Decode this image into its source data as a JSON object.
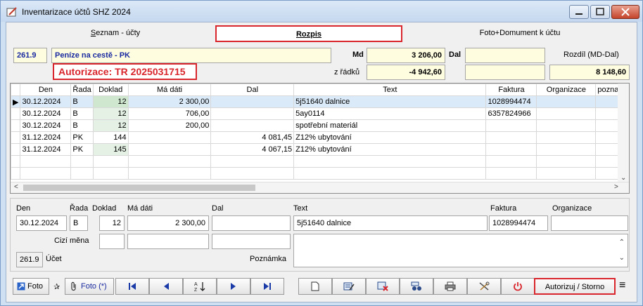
{
  "window": {
    "title": "Inventarizace účtů SHZ 2024"
  },
  "tabs": [
    {
      "label": "Seznam - účty",
      "underline": "S",
      "rest": "eznam - účty"
    },
    {
      "label": "Rozpis"
    },
    {
      "label": "Foto+Domument k účtu"
    }
  ],
  "account": {
    "code": "261.9",
    "name": "Peníze na cestě - PK",
    "authorization": "Autorizace: TR  2025031715"
  },
  "summary": {
    "md_label": "Md",
    "md_value": "3 206,00",
    "dal_label": "Dal",
    "dal_value": "",
    "rozdil_label": "Rozdíl (MD-Dal)",
    "zradku_label": "z řádků",
    "zradku_value": "-4 942,60",
    "zradku_dal": "",
    "rozdil_value": "8 148,60"
  },
  "grid": {
    "columns": [
      "Den",
      "Řada",
      "Doklad",
      "Má dáti",
      "Dal",
      "Text",
      "Faktura",
      "Organizace",
      "poznaml"
    ],
    "rows": [
      {
        "den": "30.12.2024",
        "rada": "B",
        "doklad": "12",
        "madati": "2 300,00",
        "dal": "",
        "text": "5j51640 dalnice",
        "faktura": "1028994474",
        "org": "",
        "pozn": ""
      },
      {
        "den": "30.12.2024",
        "rada": "B",
        "doklad": "12",
        "madati": "706,00",
        "dal": "",
        "text": "5ay0114",
        "faktura": "6357824966",
        "org": "",
        "pozn": ""
      },
      {
        "den": "30.12.2024",
        "rada": "B",
        "doklad": "12",
        "madati": "200,00",
        "dal": "",
        "text": "spotřební materiál",
        "faktura": "",
        "org": "",
        "pozn": ""
      },
      {
        "den": "31.12.2024",
        "rada": "PK",
        "doklad": "144",
        "madati": "",
        "dal": "4 081,45",
        "text": "Z12% ubytování",
        "faktura": "",
        "org": "",
        "pozn": ""
      },
      {
        "den": "31.12.2024",
        "rada": "PK",
        "doklad": "145",
        "madati": "",
        "dal": "4 067,15",
        "text": "Z12% ubytování",
        "faktura": "",
        "org": "",
        "pozn": ""
      }
    ]
  },
  "detail": {
    "labels": {
      "den": "Den",
      "rada": "Řada",
      "doklad": "Doklad",
      "madati": "Má dáti",
      "dal": "Dal",
      "text": "Text",
      "faktura": "Faktura",
      "organizace": "Organizace",
      "cizi_mena": "Cizí měna",
      "ucet": "Účet",
      "poznamka": "Poznámka"
    },
    "values": {
      "den": "30.12.2024",
      "rada": "B",
      "doklad": "12",
      "madati": "2 300,00",
      "dal": "",
      "text": "5j51640 dalnice",
      "faktura": "1028994474",
      "organizace": "",
      "ucet": "261.9"
    }
  },
  "toolbar": {
    "foto1": "Foto",
    "foto2": "Foto (*)",
    "authorize": "Autorizuj / Storno"
  },
  "colors": {
    "accent_red": "#d9262c",
    "label_blue": "#1a2aa0",
    "yellow_field": "#fffde0"
  }
}
